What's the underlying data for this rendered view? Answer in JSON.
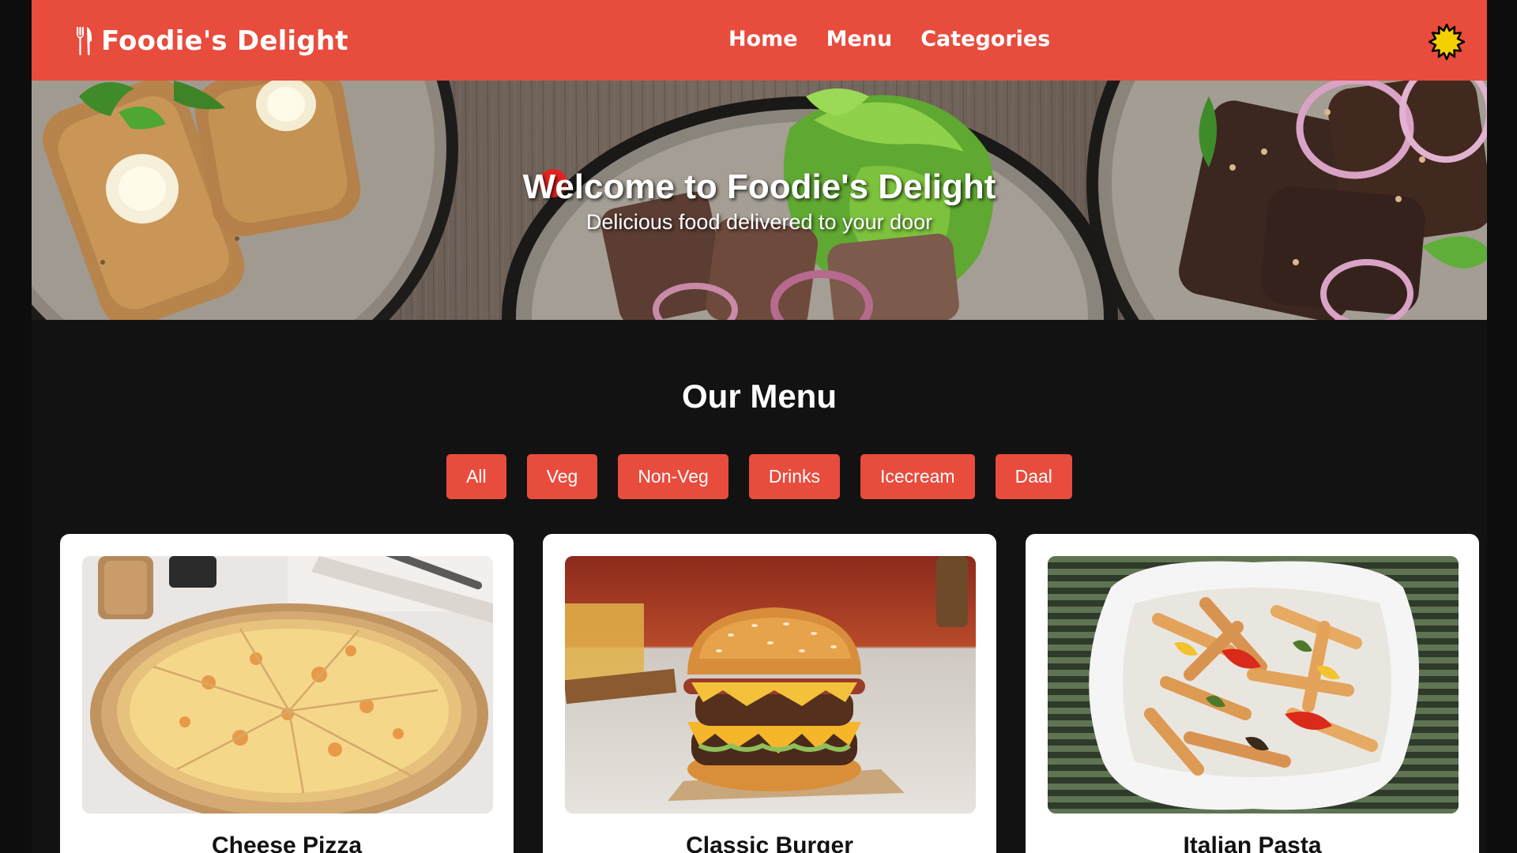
{
  "header": {
    "brand": "Foodie's Delight",
    "brand_icon": "utensils-icon",
    "nav": [
      "Home",
      "Menu",
      "Categories"
    ],
    "theme_icon": "sun-icon",
    "colors": {
      "primary": "#e84c3d",
      "theme_icon": "#f5d000"
    }
  },
  "hero": {
    "title": "Welcome to Foodie's Delight",
    "subtitle": "Delicious food delivered to your door"
  },
  "menu": {
    "title": "Our Menu",
    "filters": [
      "All",
      "Veg",
      "Non-Veg",
      "Drinks",
      "Icecream",
      "Daal"
    ],
    "items": [
      {
        "name": "Cheese Pizza",
        "image": "cheese-pizza-image"
      },
      {
        "name": "Classic Burger",
        "image": "classic-burger-image"
      },
      {
        "name": "Italian Pasta",
        "image": "italian-pasta-image"
      }
    ]
  },
  "colors": {
    "page_background": "#121212",
    "card_background": "#ffffff",
    "button": "#e84c3d",
    "button_text": "#ffffff"
  }
}
